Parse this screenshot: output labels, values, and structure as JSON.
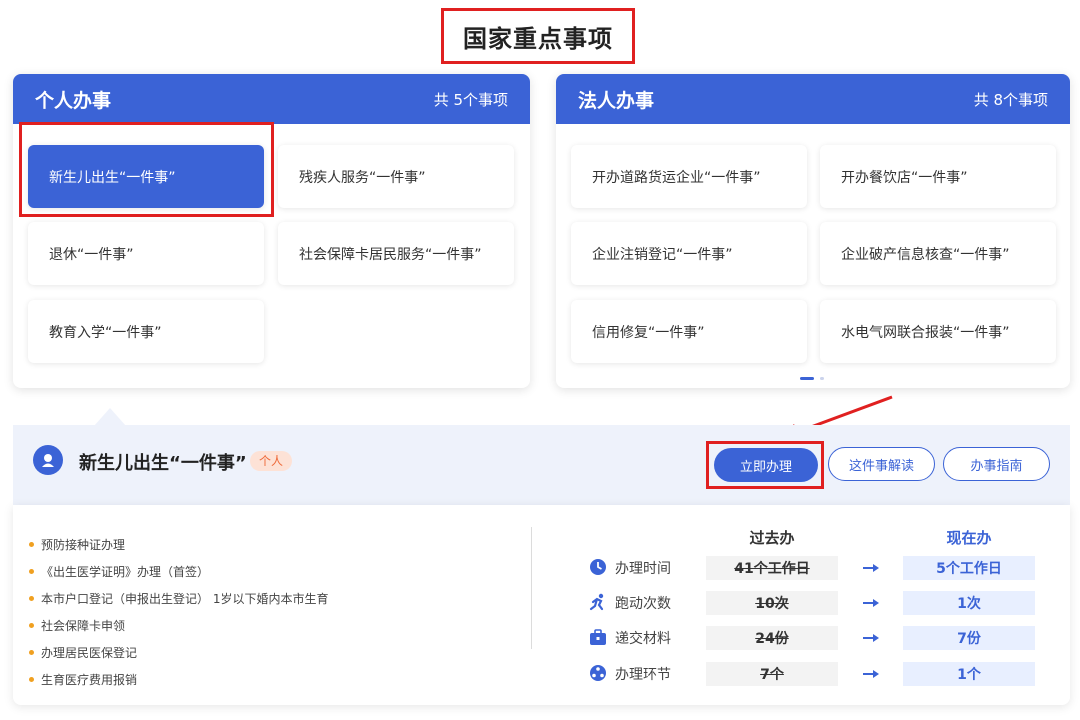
{
  "page_title": "国家重点事项",
  "personal": {
    "title": "个人办事",
    "count": "共 5个事项",
    "items": [
      "新生儿出生“一件事”",
      "残疾人服务“一件事”",
      "退休“一件事”",
      "社会保障卡居民服务“一件事”",
      "教育入学“一件事”"
    ]
  },
  "corporate": {
    "title": "法人办事",
    "count": "共 8个事项",
    "items": [
      "开办道路货运企业“一件事”",
      "开办餐饮店“一件事”",
      "企业注销登记“一件事”",
      "企业破产信息核查“一件事”",
      "信用修复“一件事”",
      "水电气网联合报装“一件事”"
    ]
  },
  "selected": {
    "title": "新生儿出生“一件事”",
    "badge": "个人",
    "buttons": {
      "apply": "立即办理",
      "explain": "这件事解读",
      "guide": "办事指南"
    }
  },
  "steps": [
    "预防接种证办理",
    "《出生医学证明》办理（首签）",
    "本市户口登记（申报出生登记） 1岁以下婚内本市生育",
    "社会保障卡申领",
    "办理居民医保登记",
    "生育医疗费用报销"
  ],
  "comparison": {
    "past_label": "过去办",
    "now_label": "现在办",
    "rows": [
      {
        "icon": "clock-icon",
        "label": "办理时间",
        "past": "41个工作日",
        "now": "5个工作日"
      },
      {
        "icon": "running-icon",
        "label": "跑动次数",
        "past": "10次",
        "now": "1次"
      },
      {
        "icon": "briefcase-icon",
        "label": "递交材料",
        "past": "24份",
        "now": "7份"
      },
      {
        "icon": "process-icon",
        "label": "办理环节",
        "past": "7个",
        "now": "1个"
      }
    ]
  },
  "colors": {
    "primary": "#3b63d6",
    "highlight": "#e02020",
    "badge_text": "#ee6a3a",
    "bullet": "#f0a020"
  }
}
